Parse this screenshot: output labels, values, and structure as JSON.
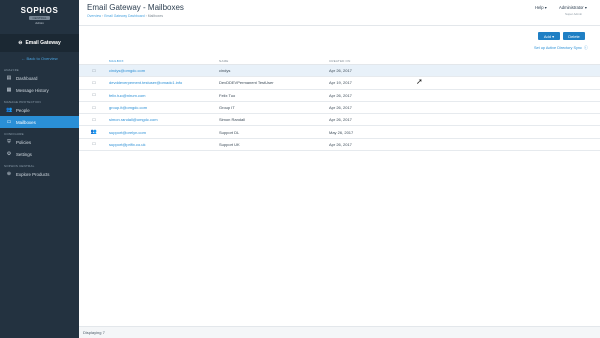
{
  "brand": {
    "logo": "SOPHOS",
    "badge": "CENTRAL",
    "sub": "Admin"
  },
  "sidebar": {
    "product": "Email Gateway",
    "back": "Back to Overview",
    "sections": {
      "analyze": "ANALYZE",
      "manage": "MANAGE PROTECTION",
      "configure": "CONFIGURE",
      "central": "SOPHOS CENTRAL"
    },
    "items": [
      {
        "label": "Dashboard",
        "icon": "dashboard-icon"
      },
      {
        "label": "Message History",
        "icon": "message-history-icon"
      },
      {
        "label": "People",
        "icon": "people-icon"
      },
      {
        "label": "Mailboxes",
        "icon": "mailbox-icon"
      },
      {
        "label": "Policies",
        "icon": "shield-icon"
      },
      {
        "label": "Settings",
        "icon": "gear-icon"
      },
      {
        "label": "Explore Products",
        "icon": "plus-circle-icon"
      }
    ]
  },
  "header": {
    "title": "Email Gateway - Mailboxes",
    "breadcrumbs": [
      "Overview",
      "Email Gateway Dashboard",
      "Mailboxes"
    ],
    "help": "Help",
    "user": "Administrator",
    "role": "Super Admin"
  },
  "toolbar": {
    "add_label": "Add",
    "delete_label": "Delete",
    "sync_label": "Set up Active Directory Sync"
  },
  "table": {
    "columns": [
      "MAILBOX",
      "NAME",
      "CREATED ON"
    ],
    "rows": [
      {
        "type": "mailbox",
        "address": "cindys@omgdc.com",
        "name": "cindys",
        "created": "Apr 26, 2017"
      },
      {
        "type": "mailbox",
        "address": "devddeverpement.testuser@omadc1.info",
        "name": "DevDDEVPermanent TestUser",
        "created": "Apr 19, 2017"
      },
      {
        "type": "mailbox",
        "address": "felix.tuo@nirum.com",
        "name": "Felix Tuo",
        "created": "Apr 26, 2017"
      },
      {
        "type": "mailbox",
        "address": "group.it@omgdc.com",
        "name": "Group IT",
        "created": "Apr 26, 2017"
      },
      {
        "type": "mailbox",
        "address": "simon.randall@omgdc.com",
        "name": "Simon Randall",
        "created": "Apr 26, 2017"
      },
      {
        "type": "group",
        "address": "support@orelyn.com",
        "name": "Support DL",
        "created": "May 26, 2017"
      },
      {
        "type": "mailbox",
        "address": "support@prifix.co.uk",
        "name": "Support UK",
        "created": "Apr 26, 2017"
      }
    ]
  },
  "footer": {
    "displaying": "Displaying 7"
  }
}
